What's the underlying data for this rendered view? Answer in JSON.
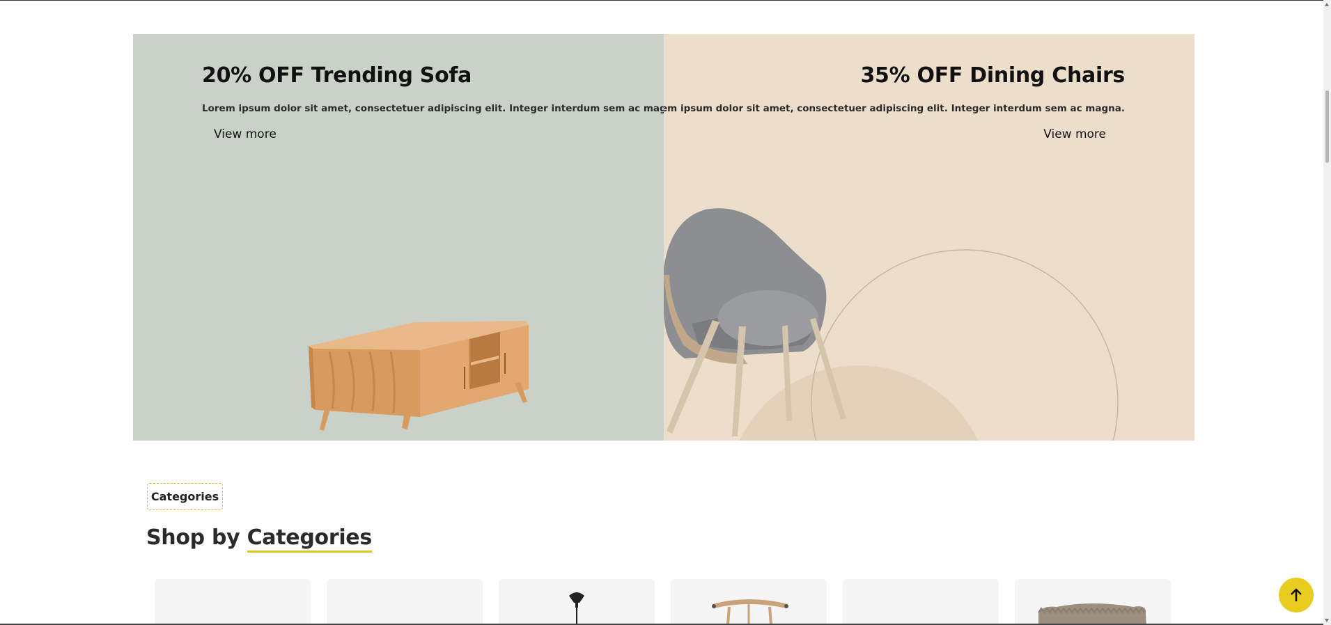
{
  "promos": [
    {
      "title": "20% OFF Trending Sofa",
      "text": "Lorem ipsum dolor sit amet, consectetuer adipiscing elit. Integer interdum sem ac magna.",
      "link_label": "View more",
      "image_icon": "tv-cabinet-illustration",
      "background": "#c9d1c8"
    },
    {
      "title": "35% OFF Dining Chairs",
      "text": "Lorem ipsum dolor sit amet, consectetuer adipiscing elit. Integer interdum sem ac magna.",
      "link_label": "View more",
      "image_icon": "armchair-illustration",
      "background": "#ecdeca"
    }
  ],
  "categories": {
    "tag": "Categories",
    "heading_prefix": "Shop by",
    "heading_accent": "Categories",
    "accent_color": "#e0c31e",
    "cards": [
      {
        "icon": "empty-category-card"
      },
      {
        "icon": "empty-category-card"
      },
      {
        "icon": "pendant-lamp-icon"
      },
      {
        "icon": "wooden-chair-icon"
      },
      {
        "icon": "empty-category-card"
      },
      {
        "icon": "cushion-icon"
      }
    ]
  },
  "scroll_top": {
    "icon": "arrow-up-icon",
    "color": "#e8cc1f"
  }
}
